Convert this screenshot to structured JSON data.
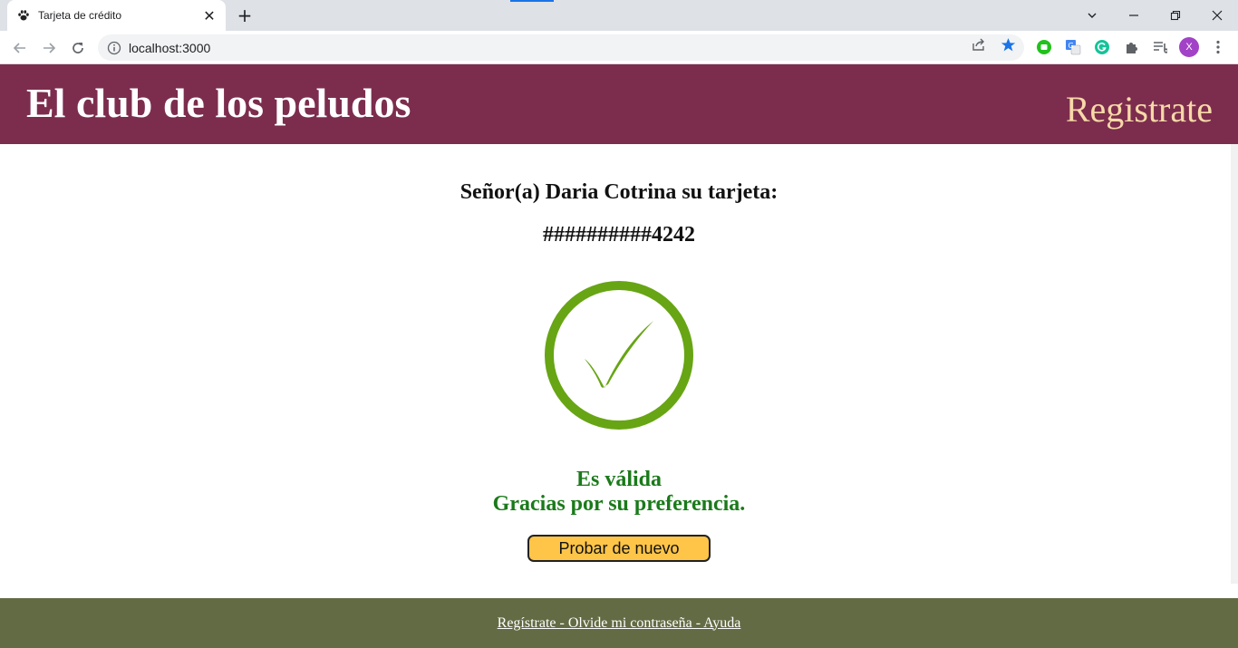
{
  "browser": {
    "tab_title": "Tarjeta de crédito",
    "url": "localhost:3000",
    "profile_initial": "X"
  },
  "header": {
    "site_title": "El club de los peludos",
    "register_label": "Registrate"
  },
  "main": {
    "greeting": "Señor(a) Daria Cotrina su tarjeta:",
    "card_number": "##########4242",
    "valid_text": "Es válida",
    "thanks_text": "Gracias por su preferencia.",
    "retry_label": "Probar de nuevo"
  },
  "footer": {
    "links_text": "Regístrate - Olvide mi contraseña - Ayuda"
  },
  "colors": {
    "header_bg": "#7c2d4e",
    "footer_bg": "#636b44",
    "check_green": "#67a514",
    "valid_text": "#1a7a1a",
    "button_bg": "#fec548"
  }
}
